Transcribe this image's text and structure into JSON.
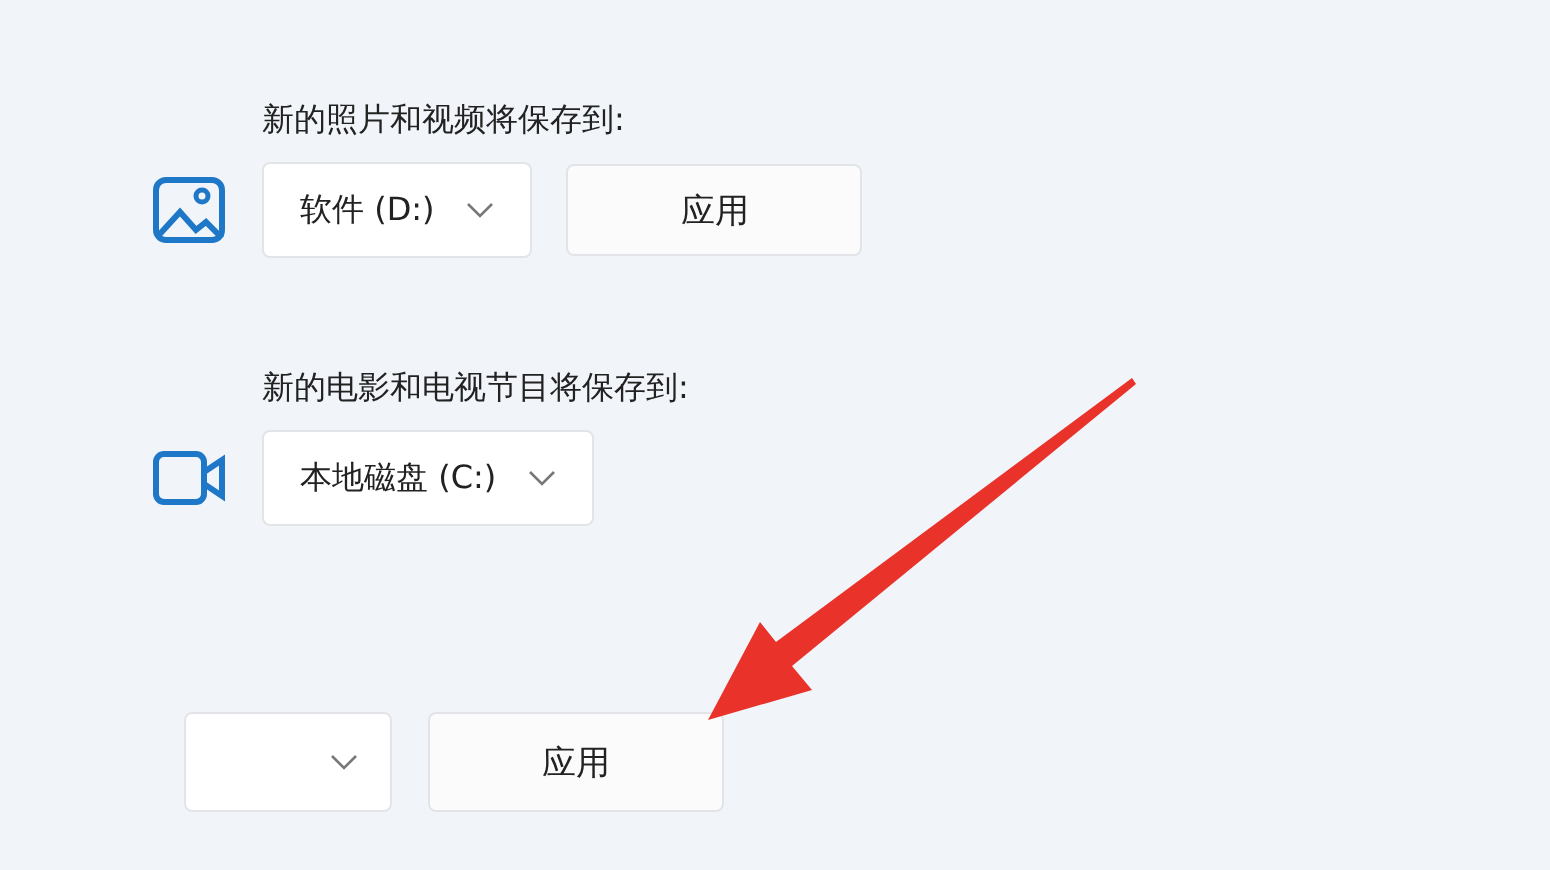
{
  "sections": [
    {
      "label": "新的照片和视频将保存到:",
      "kind": "photos",
      "drive": "软件 (D:)",
      "apply": "应用"
    },
    {
      "label": "新的电影和电视节目将保存到:",
      "kind": "videos",
      "drive": "本地磁盘 (C:)"
    }
  ],
  "bottom": {
    "apply": "应用"
  }
}
